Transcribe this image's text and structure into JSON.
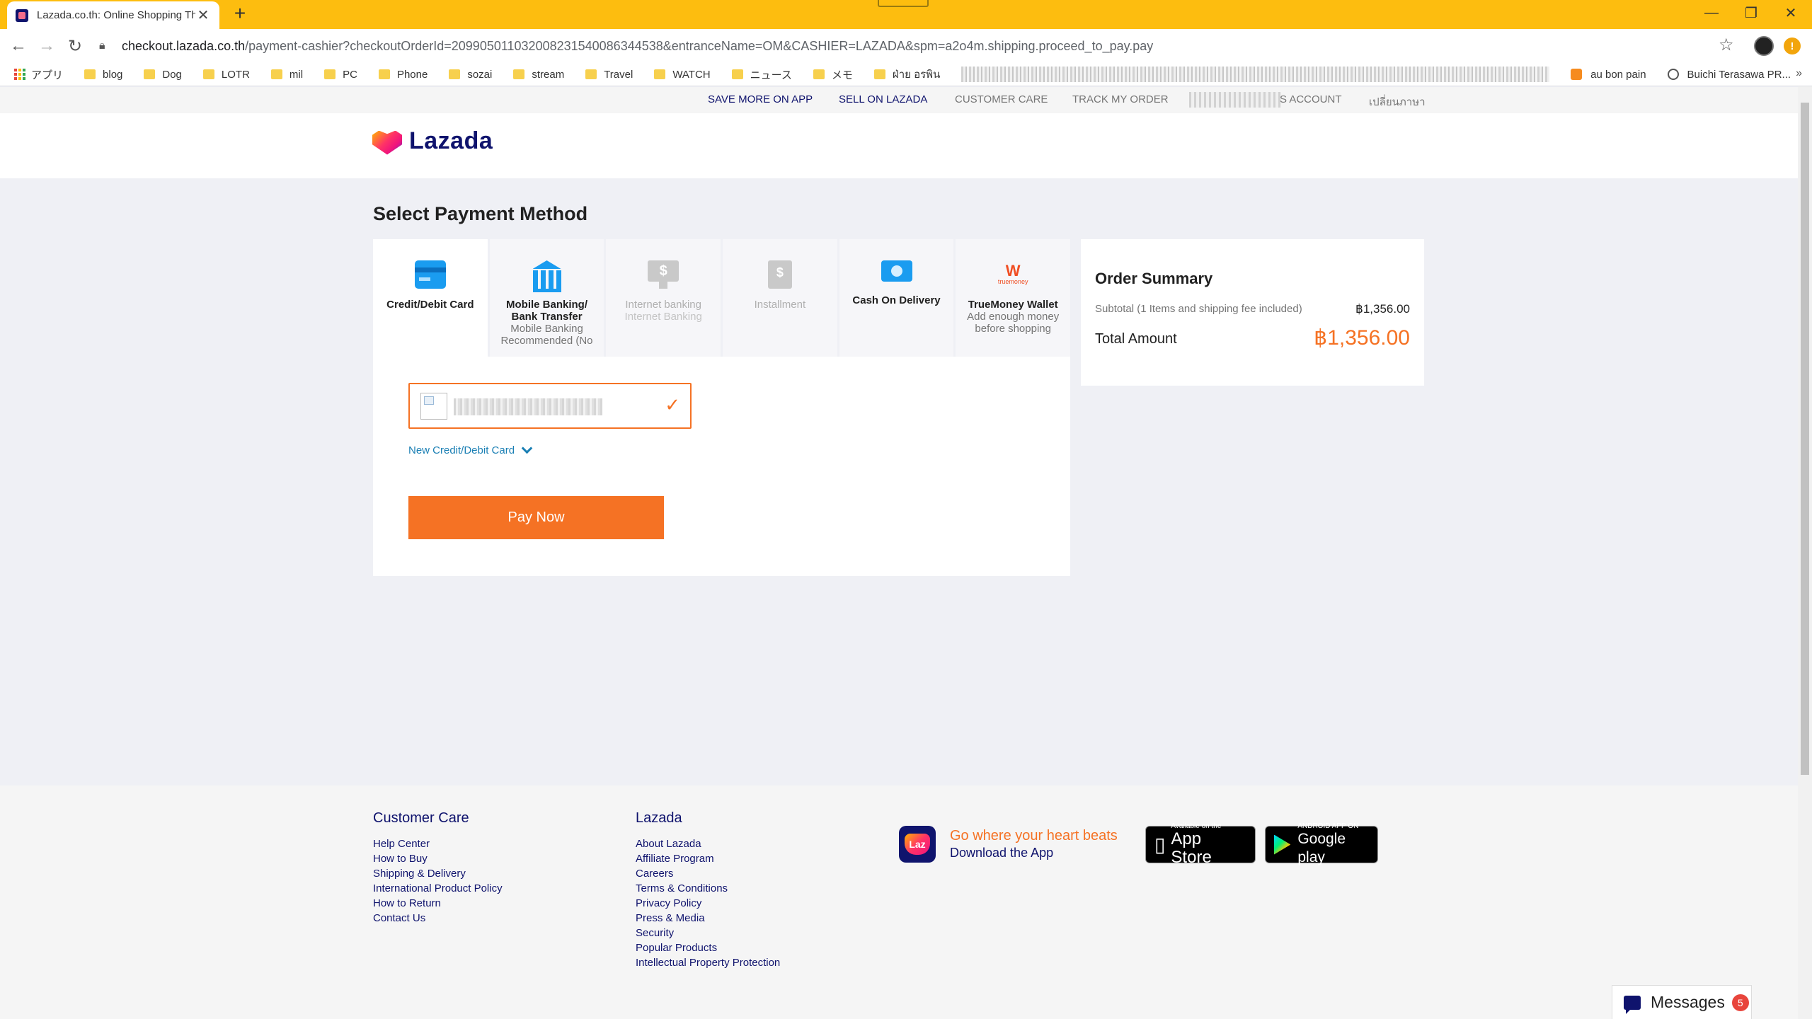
{
  "browser": {
    "tab_title": "Lazada.co.th: Online Shopping Th",
    "url_host": "checkout.lazada.co.th",
    "url_path": "/payment-cashier?checkoutOrderId=209905011032008231540086344538&entranceName=OM&CASHIER=LAZADA&spm=a2o4m.shipping.proceed_to_pay.pay",
    "alert_badge": "!",
    "bookmarks": [
      "アプリ",
      "blog",
      "Dog",
      "LOTR",
      "mil",
      "PC",
      "Phone",
      "sozai",
      "stream",
      "Travel",
      "WATCH",
      "ニュース",
      "メモ",
      "ฝ่าย อรพิน"
    ],
    "bookmarks_right": [
      "au bon pain",
      "Buichi Terasawa PR..."
    ]
  },
  "topnav": {
    "save_more": "SAVE MORE ON APP",
    "sell": "SELL ON LAZADA",
    "customer_care": "CUSTOMER CARE",
    "track": "TRACK MY ORDER",
    "account": "S ACCOUNT",
    "language": "เปลี่ยนภาษา"
  },
  "brand": {
    "name": "Lazada"
  },
  "payment": {
    "title": "Select Payment Method",
    "methods": [
      {
        "name": "Credit/Debit Card",
        "sub": "",
        "icon": "credit-card-icon",
        "state": "selected"
      },
      {
        "name": "Mobile Banking/ Bank Transfer",
        "sub": "Mobile Banking Recommended (No",
        "icon": "bank-icon",
        "state": "enabled"
      },
      {
        "name": "Internet banking",
        "sub": "Internet Banking",
        "icon": "monitor-dollar-icon",
        "state": "disabled"
      },
      {
        "name": "Installment",
        "sub": "",
        "icon": "installment-icon",
        "state": "disabled"
      },
      {
        "name": "Cash On Delivery",
        "sub": "",
        "icon": "cash-icon",
        "state": "enabled"
      },
      {
        "name": "TrueMoney Wallet",
        "sub": "Add enough money before shopping",
        "icon": "truemoney-icon",
        "state": "enabled"
      }
    ],
    "new_card_label": "New Credit/Debit Card",
    "pay_button": "Pay Now",
    "accent_color": "#f57224"
  },
  "summary": {
    "title": "Order Summary",
    "subtotal_label": "Subtotal (1 Items and shipping fee included)",
    "subtotal_value": "฿1,356.00",
    "total_label": "Total Amount",
    "total_value": "฿1,356.00"
  },
  "footer": {
    "customer_care": {
      "title": "Customer Care",
      "links": [
        "Help Center",
        "How to Buy",
        "Shipping & Delivery",
        "International Product Policy",
        "How to Return",
        "Contact Us"
      ]
    },
    "lazada": {
      "title": "Lazada",
      "links": [
        "About Lazada",
        "Affiliate Program",
        "Careers",
        "Terms & Conditions",
        "Privacy Policy",
        "Press & Media",
        "Security",
        "Popular Products",
        "Intellectual Property Protection"
      ]
    },
    "promo_line1": "Go where your heart beats",
    "promo_line2": "Download the App",
    "appstore_small": "Available on the",
    "appstore_big": "App Store",
    "googleplay_small": "ANDROID APP ON",
    "googleplay_big": "Google play"
  },
  "messages": {
    "label": "Messages",
    "count": "5"
  }
}
